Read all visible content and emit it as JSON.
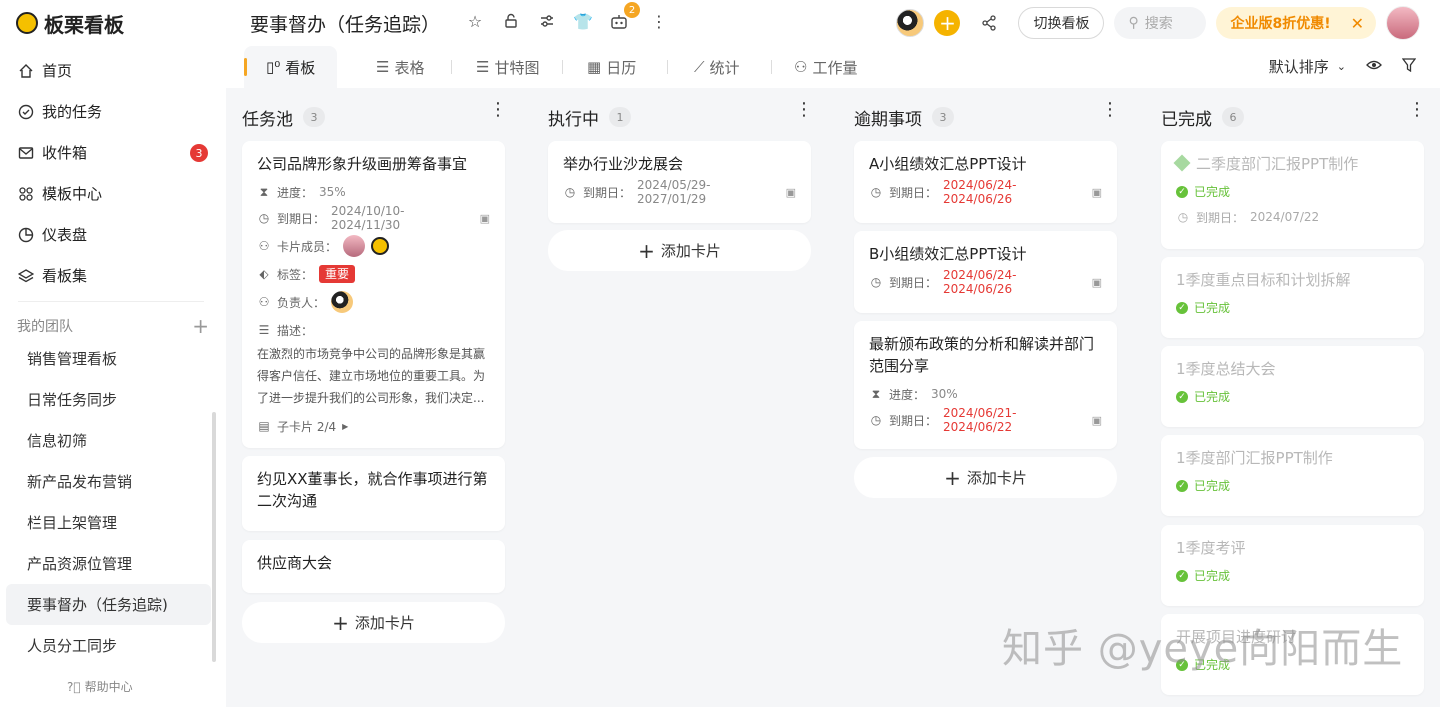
{
  "app": {
    "name": "板栗看板"
  },
  "sidebar": {
    "nav": [
      {
        "label": "首页",
        "icon": "home-icon"
      },
      {
        "label": "我的任务",
        "icon": "check-circle-icon"
      },
      {
        "label": "收件箱",
        "icon": "mail-icon",
        "badge": "3"
      },
      {
        "label": "模板中心",
        "icon": "template-icon"
      },
      {
        "label": "仪表盘",
        "icon": "pie-chart-icon"
      },
      {
        "label": "看板集",
        "icon": "layers-icon"
      }
    ],
    "team_header": "我的团队",
    "teams": [
      "销售管理看板",
      "日常任务同步",
      "信息初筛",
      "新产品发布营销",
      "栏目上架管理",
      "产品资源位管理",
      "要事督办（任务追踪)",
      "人员分工同步"
    ],
    "help": "帮助中心"
  },
  "header": {
    "title": "要事督办（任务追踪）",
    "robot_badge": "2",
    "switch_board": "切换看板",
    "search_placeholder": "搜索",
    "promo": "企业版8折优惠!"
  },
  "tabs": [
    {
      "label": "看板",
      "icon": "board-icon"
    },
    {
      "label": "表格",
      "icon": "list-icon"
    },
    {
      "label": "甘特图",
      "icon": "gantt-icon"
    },
    {
      "label": "日历",
      "icon": "calendar-icon"
    },
    {
      "label": "统计",
      "icon": "chart-icon"
    },
    {
      "label": "工作量",
      "icon": "workload-icon"
    }
  ],
  "sort": "默认排序",
  "labels": {
    "progress": "进度：",
    "due": "到期日：",
    "members": "卡片成员：",
    "tags": "标签：",
    "owner": "负责人：",
    "desc": "描述：",
    "subcard": "子卡片 2/4",
    "add_card": "添加卡片",
    "done": "已完成"
  },
  "columns": [
    {
      "title": "任务池",
      "count": "3",
      "cards": [
        {
          "title": "公司品牌形象升级画册筹备事宜",
          "progress": "35%",
          "due": "2024/10/10-2024/11/30",
          "tag": "重要",
          "desc": "在激烈的市场竞争中公司的品牌形象是其赢得客户信任、建立市场地位的重要工具。为了进一步提升我们的公司形象，我们决定..."
        },
        {
          "title": "约见XX董事长，就合作事项进行第二次沟通"
        },
        {
          "title": "供应商大会"
        }
      ]
    },
    {
      "title": "执行中",
      "count": "1",
      "cards": [
        {
          "title": "举办行业沙龙展会",
          "due": "2024/05/29-2027/01/29"
        }
      ]
    },
    {
      "title": "逾期事项",
      "count": "3",
      "cards": [
        {
          "title": "A小组绩效汇总PPT设计",
          "due": "2024/06/24-2024/06/26"
        },
        {
          "title": "B小组绩效汇总PPT设计",
          "due": "2024/06/24-2024/06/26"
        },
        {
          "title": "最新颁布政策的分析和解读并部门范围分享",
          "progress": "30%",
          "due": "2024/06/21-2024/06/22"
        }
      ]
    },
    {
      "title": "已完成",
      "count": "6",
      "cards": [
        {
          "title": "二季度部门汇报PPT制作",
          "due": "2024/07/22"
        },
        {
          "title": "1季度重点目标和计划拆解"
        },
        {
          "title": "1季度总结大会"
        },
        {
          "title": "1季度部门汇报PPT制作"
        },
        {
          "title": "1季度考评"
        },
        {
          "title": "开展项目进度研讨"
        }
      ]
    }
  ],
  "watermark": "知乎 @yeye向阳而生",
  "colors": {
    "accent": "#f5a623",
    "overdue": "#e53935",
    "done": "#67c23a"
  }
}
